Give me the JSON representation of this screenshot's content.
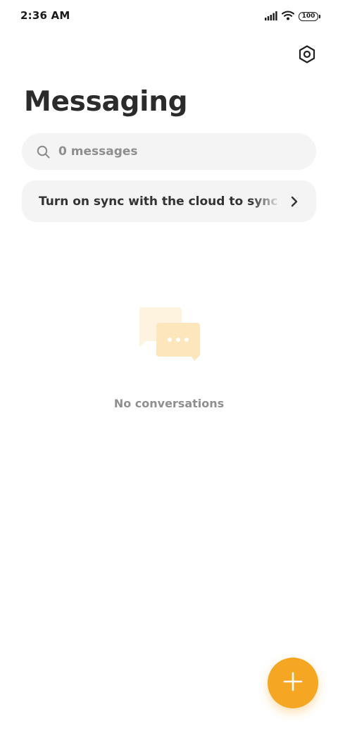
{
  "status_bar": {
    "time": "2:36 AM",
    "battery": "100",
    "icons": [
      "signal-icon",
      "wifi-icon",
      "battery-icon"
    ]
  },
  "header": {
    "title": "Messaging",
    "settings_icon": "settings-hexagon-icon"
  },
  "search": {
    "placeholder": "0 messages",
    "icon": "search-icon"
  },
  "sync_banner": {
    "text": "Turn on sync with the cloud to sync messages",
    "icon": "chevron-right-icon"
  },
  "empty_state": {
    "label": "No conversations",
    "icon": "chat-bubbles-icon"
  },
  "fab": {
    "icon": "plus-icon"
  },
  "colors": {
    "accent": "#f5a623",
    "illustration_light": "#fdf0d5",
    "illustration_dark": "#fde3b2"
  }
}
